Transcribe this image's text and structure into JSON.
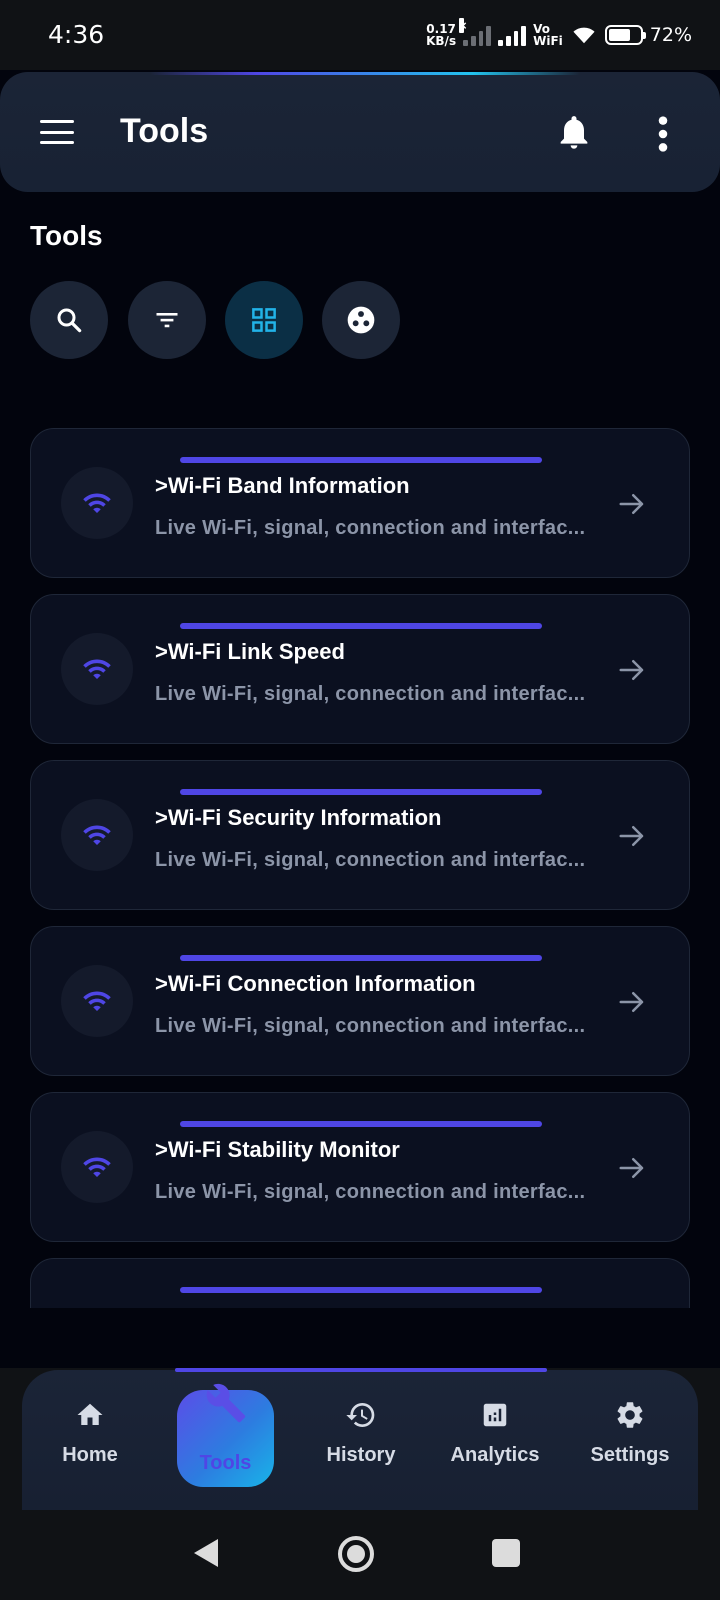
{
  "status_bar": {
    "time": "4:36",
    "net_speed_value": "0.17",
    "net_speed_unit": "KB/s",
    "vowifi_top": "Vo",
    "vowifi_bottom": "WiFi",
    "battery": "72%",
    "battery_level": 0.72
  },
  "app_bar": {
    "title": "Tools",
    "menu_icon": "menu-icon",
    "bell_icon": "bell-icon",
    "more_icon": "more-vert-icon",
    "glow_colors": [
      "#4f46e5",
      "#22c2ee"
    ]
  },
  "section": {
    "title": "Tools"
  },
  "chips": [
    {
      "icon": "search-icon",
      "active": false
    },
    {
      "icon": "filter-icon",
      "active": false
    },
    {
      "icon": "grid-view-icon",
      "active": true
    },
    {
      "icon": "category-icon",
      "active": false
    }
  ],
  "cards": [
    {
      "title": ">Wi-Fi Band Information",
      "description": "Live Wi-Fi, signal, connection and interfac...",
      "icon": "wifi-icon"
    },
    {
      "title": ">Wi-Fi Link Speed",
      "description": "Live Wi-Fi, signal, connection and interfac...",
      "icon": "wifi-icon"
    },
    {
      "title": ">Wi-Fi Security Information",
      "description": "Live Wi-Fi, signal, connection and interfac...",
      "icon": "wifi-icon"
    },
    {
      "title": ">Wi-Fi Connection Information",
      "description": "Live Wi-Fi, signal, connection and interfac...",
      "icon": "wifi-icon"
    },
    {
      "title": ">Wi-Fi Stability Monitor",
      "description": "Live Wi-Fi, signal, connection and interfac...",
      "icon": "wifi-icon"
    }
  ],
  "bottom_nav": {
    "items": [
      {
        "label": "Home",
        "icon": "home-icon",
        "active": false
      },
      {
        "label": "Tools",
        "icon": "wrench-icon",
        "active": true
      },
      {
        "label": "History",
        "icon": "history-icon",
        "active": false
      },
      {
        "label": "Analytics",
        "icon": "analytics-icon",
        "active": false
      },
      {
        "label": "Settings",
        "icon": "gear-icon",
        "active": false
      }
    ]
  },
  "colors": {
    "accent": "#4f46e5",
    "accent_cyan": "#22c2ee",
    "background": "#02040d",
    "card": "#0b1020",
    "muted_text": "#8c95a8"
  }
}
